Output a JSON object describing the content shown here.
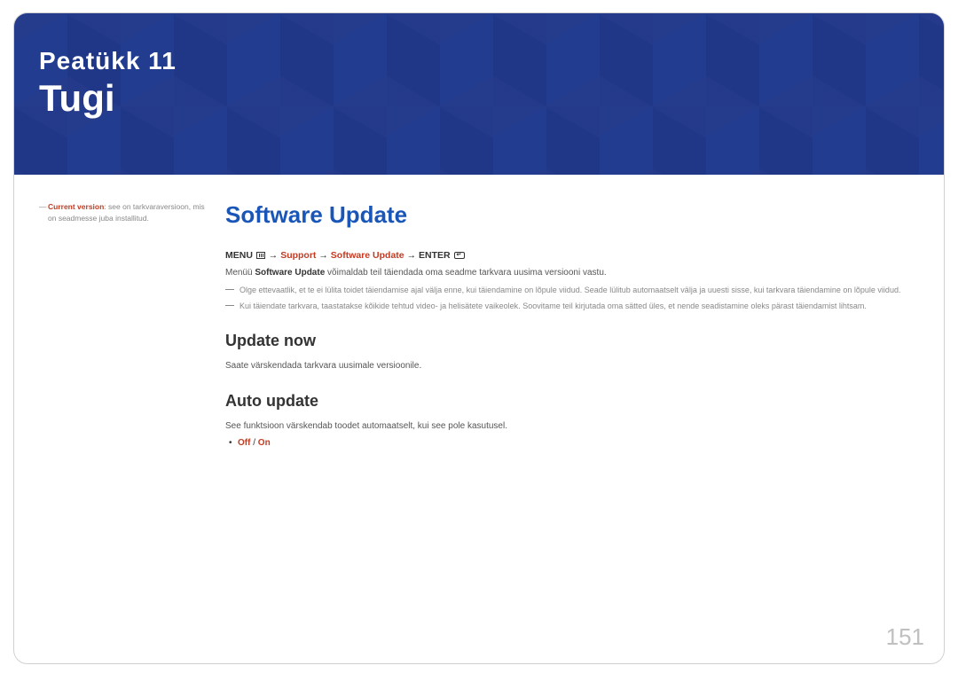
{
  "header": {
    "chapter_label": "Peatükk 11",
    "chapter_title": "Tugi"
  },
  "sidebar": {
    "note_prefix": "―",
    "note_highlight": "Current version",
    "note_text": ": see on tarkvaraversioon, mis on seadmesse juba installitud."
  },
  "main": {
    "section_title": "Software Update",
    "menu_path": {
      "menu_label": "MENU",
      "arrow": "→",
      "support": "Support",
      "software_update": "Software Update",
      "enter_label": "ENTER"
    },
    "intro_text_pre": "Menüü ",
    "intro_text_bold": "Software Update",
    "intro_text_post": " võimaldab teil täiendada oma seadme tarkvara uusima versiooni vastu.",
    "note1": "Olge ettevaatlik, et te ei lülita toidet täiendamise ajal välja enne, kui täiendamine on lõpule viidud. Seade lülitub automaatselt välja ja uuesti sisse, kui tarkvara täiendamine on lõpule viidud.",
    "note2": "Kui täiendate tarkvara, taastatakse kõikide tehtud video- ja helisätete vaikeolek. Soovitame teil kirjutada oma sätted üles, et nende seadistamine oleks pärast täiendamist lihtsam.",
    "update_now_title": "Update now",
    "update_now_text": "Saate värskendada tarkvara uusimale versioonile.",
    "auto_update_title": "Auto update",
    "auto_update_text": "See funktsioon värskendab toodet automaatselt, kui see pole kasutusel.",
    "option_off": "Off",
    "option_sep": " / ",
    "option_on": "On"
  },
  "page_number": "151"
}
